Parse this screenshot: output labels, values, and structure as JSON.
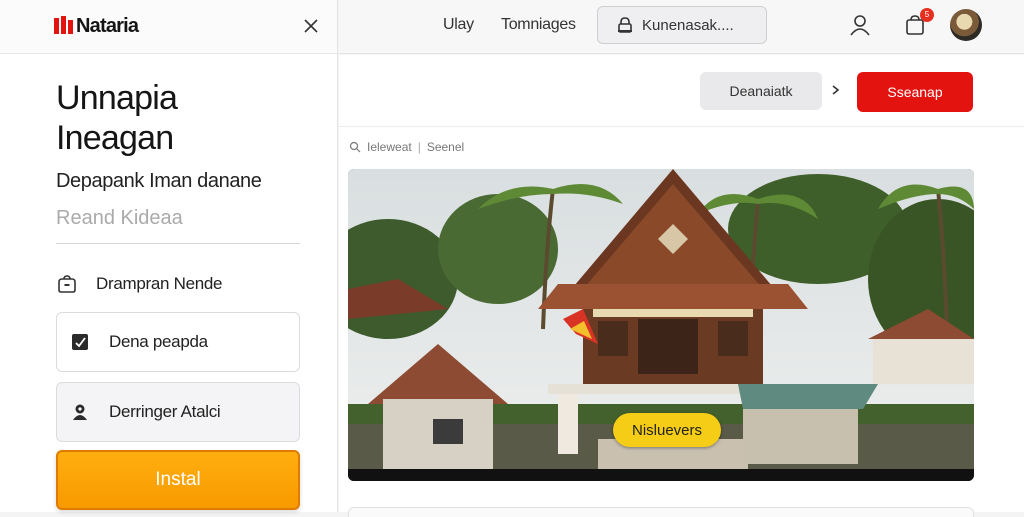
{
  "app": {
    "logo_text": "Nataria",
    "brand_color": "#e3130f"
  },
  "left_panel": {
    "title": "Unnapia Ineagan",
    "subtitle": "Depapank Iman danane",
    "input_placeholder": "Reand Kideaa",
    "options": [
      {
        "label": "Drampran Nende",
        "icon": "bag-icon"
      },
      {
        "label": "Dena peapda",
        "icon": "checkbox-icon"
      },
      {
        "label": "Derringer Atalci",
        "icon": "user-pin-icon"
      }
    ],
    "install_label": "Instal"
  },
  "topnav": {
    "links": [
      "Ulay",
      "Tomniages"
    ],
    "search_text": "Kunenasak....",
    "cart_badge": "5"
  },
  "main": {
    "secondary_button": "Deanaiatk",
    "primary_button": "Sseanap",
    "breadcrumb": [
      "Ieleweat",
      "Seenel"
    ],
    "hero_pill": "Nisluevers"
  }
}
